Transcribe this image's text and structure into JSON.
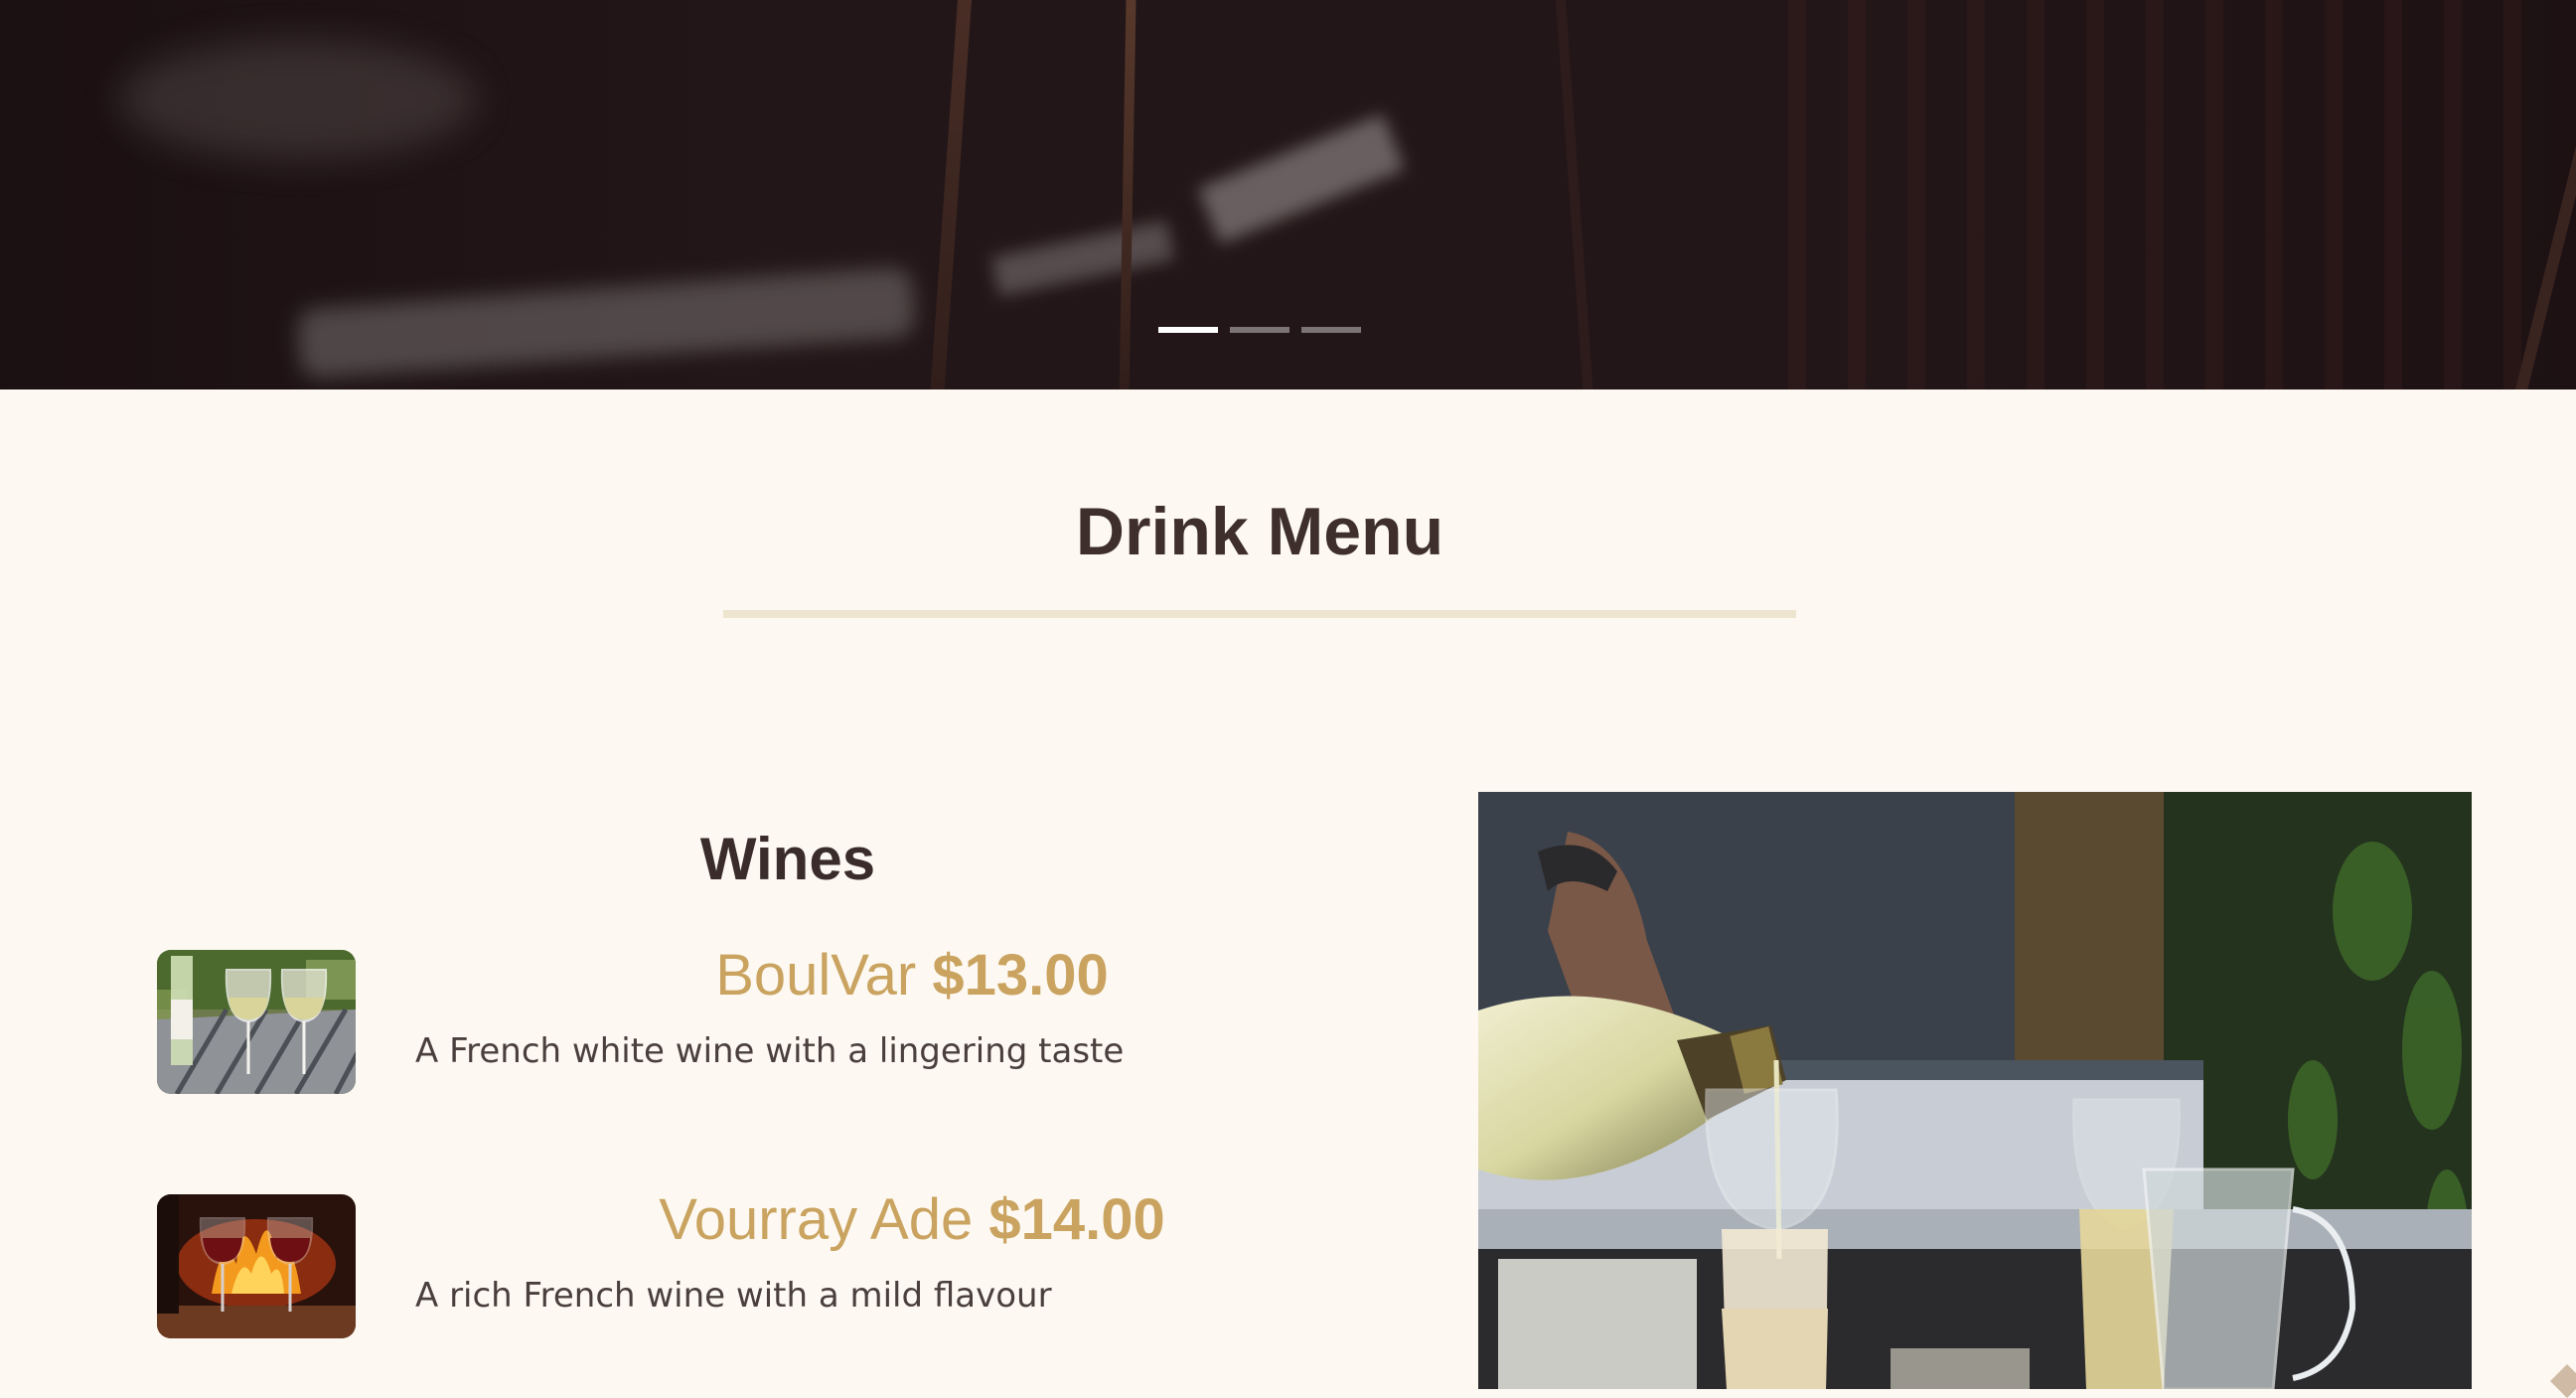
{
  "hero": {
    "carousel": {
      "slide_count": 3,
      "active_index": 0,
      "indicators": [
        {
          "label": "slide-1",
          "active": true
        },
        {
          "label": "slide-2",
          "active": false
        },
        {
          "label": "slide-3",
          "active": false
        }
      ]
    }
  },
  "menu": {
    "title": "Drink Menu",
    "category": "Wines",
    "items": [
      {
        "name": "BoulVar",
        "price": "$13.00",
        "description": "A French white wine with a lingering taste",
        "thumbnail_icon": "white-wine-glasses-image"
      },
      {
        "name": "Vourray Ade",
        "price": "$14.00",
        "description": "A rich French wine with a mild flavour",
        "thumbnail_icon": "red-wine-fireplace-image"
      }
    ]
  },
  "colors": {
    "page_background": "#fdf9f2",
    "hero_background": "#231618",
    "accent_gold": "#c9a35f",
    "heading_brown": "#3f2f2c",
    "title_rule": "#ede5cf"
  }
}
